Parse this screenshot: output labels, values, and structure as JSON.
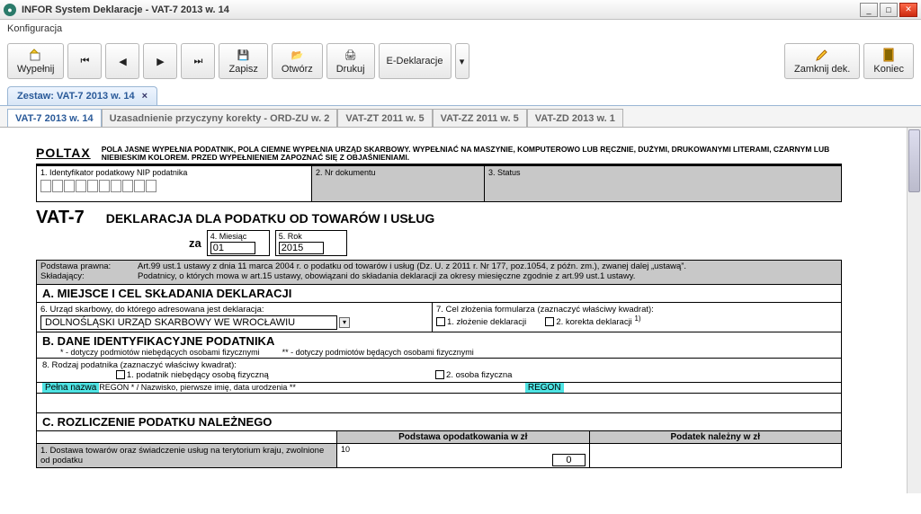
{
  "window": {
    "title": "INFOR System Deklaracje - VAT-7 2013 w. 14",
    "menu_config": "Konfiguracja"
  },
  "toolbar": {
    "fill": "Wypełnij",
    "save": "Zapisz",
    "open": "Otwórz",
    "print": "Drukuj",
    "edecl": "E-Deklaracje",
    "close_decl": "Zamknij dek.",
    "exit": "Koniec"
  },
  "tabs": {
    "file_tab": "Zestaw: VAT-7 2013 w. 14",
    "sub": [
      "VAT-7 2013 w. 14",
      "Uzasadnienie przyczyny korekty - ORD-ZU w. 2",
      "VAT-ZT 2011 w. 5",
      "VAT-ZZ 2011 w. 5",
      "VAT-ZD 2013 w. 1"
    ]
  },
  "form": {
    "poltax": "POLTAX",
    "poltax_note": "POLA JASNE WYPEŁNIA PODATNIK, POLA CIEMNE WYPEŁNIA URZĄD SKARBOWY. WYPEŁNIAĆ NA MASZYNIE, KOMPUTEROWO LUB RĘCZNIE, DUŻYMI, DRUKOWANYMI LITERAMI, CZARNYM LUB NIEBIESKIM KOLOREM. PRZED WYPEŁNIENIEM ZAPOZNAĆ SIĘ Z OBJAŚNIENIAMI.",
    "f1_label": "1. Identyfikator podatkowy NIP podatnika",
    "f2_label": "2. Nr dokumentu",
    "f3_label": "3. Status",
    "vat7": "VAT-7",
    "vat7_desc": "DEKLARACJA DLA PODATKU OD TOWARÓW I USŁUG",
    "za": "za",
    "f4_label": "4. Miesiąc",
    "f4_value": "01",
    "f5_label": "5. Rok",
    "f5_value": "2015",
    "podstawa_l": "Podstawa prawna:",
    "podstawa_v": "Art.99 ust.1 ustawy z dnia 11 marca 2004 r. o podatku od towarów i usług (Dz. U. z 2011 r. Nr 177, poz.1054, z późn. zm.), zwanej dalej „ustawą”.",
    "skladajacy_l": "Składający:",
    "skladajacy_v": "Podatnicy, o których mowa w art.15 ustawy, obowiązani do składania deklaracji za okresy miesięczne zgodnie z art.99 ust.1 ustawy.",
    "secA": "A. MIEJSCE I CEL SKŁADANIA DEKLARACJI",
    "f6_label": "6. Urząd skarbowy, do którego adresowana jest deklaracja:",
    "f6_value": "DOLNOŚLĄSKI URZĄD SKARBOWY WE WROCŁAWIU",
    "f7_label": "7. Cel złożenia formularza (zaznaczyć właściwy kwadrat):",
    "f7_opt1": "1. złożenie deklaracji",
    "f7_opt2": "2. korekta deklaracji",
    "f7_note": "1)",
    "secB": "B. DANE IDENTYFIKACYJNE PODATNIKA",
    "secB_note1": "* - dotyczy podmiotów niebędących osobami fizycznymi",
    "secB_note2": "** - dotyczy podmiotów będących osobami fizycznymi",
    "f8_label": "8. Rodzaj podatnika (zaznaczyć właściwy kwadrat):",
    "f8_opt1": "1. podatnik niebędący osobą fizyczną",
    "f8_opt2": "2. osoba fizyczna",
    "hl_pelna": "Pełna nazwa",
    "hl_regon_row": "REGON * / Nazwisko, pierwsze imię, data urodzenia **",
    "hl_regon": "REGON",
    "secC": "C. ROZLICZENIE PODATKU NALEŻNEGO",
    "secC_col1": "Podstawa opodatkowania w zł",
    "secC_col2": "Podatek należny w zł",
    "secC_r1_lbl": "1. Dostawa towarów oraz świadczenie usług na terytorium kraju, zwolnione od podatku",
    "secC_r1_num": "10",
    "secC_r1_val": "0"
  }
}
